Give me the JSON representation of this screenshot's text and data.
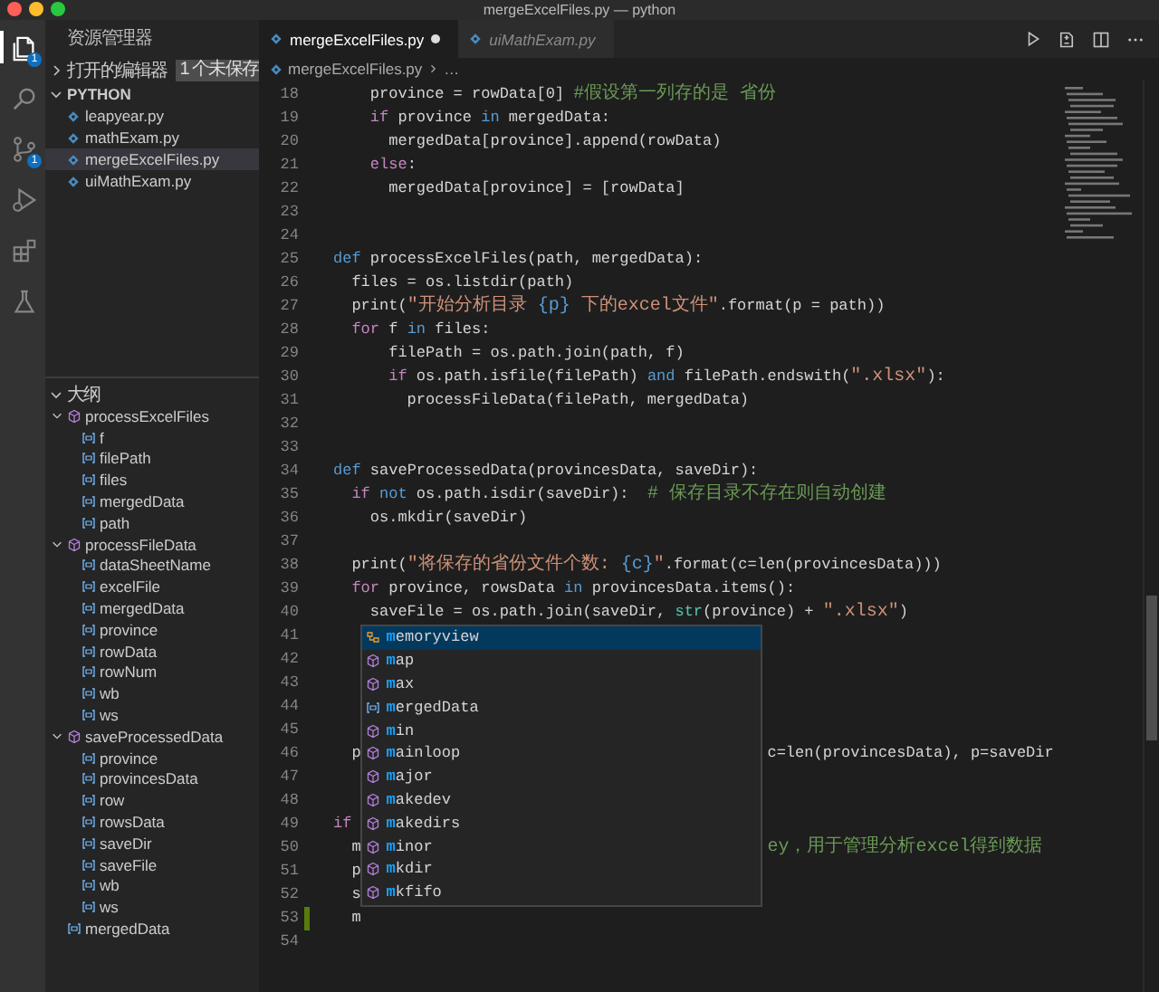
{
  "window": {
    "title": "mergeExcelFiles.py — python"
  },
  "activity_bar": [
    {
      "kind": "files",
      "selected": true,
      "badge": "1"
    },
    {
      "kind": "search",
      "selected": false
    },
    {
      "kind": "source_control",
      "selected": false,
      "badge": "1"
    },
    {
      "kind": "run",
      "selected": false
    },
    {
      "kind": "extensions",
      "selected": false
    },
    {
      "kind": "flask",
      "selected": false
    }
  ],
  "sidebar": {
    "title": "资源管理器",
    "open_editors": {
      "label": "打开的编辑器",
      "expanded": false,
      "badge": "1 个未保存"
    },
    "folder": {
      "label": "PYTHON",
      "expanded": true,
      "files": [
        {
          "name": "leapyear.py",
          "selected": false
        },
        {
          "name": "mathExam.py",
          "selected": false
        },
        {
          "name": "mergeExcelFiles.py",
          "selected": true
        },
        {
          "name": "uiMathExam.py",
          "selected": false
        }
      ]
    },
    "outline": {
      "label": "大纲",
      "expanded": true,
      "children": [
        {
          "label": "processExcelFiles",
          "kind": "function",
          "expanded": true,
          "children": [
            {
              "label": "f",
              "kind": "variable"
            },
            {
              "label": "filePath",
              "kind": "variable"
            },
            {
              "label": "files",
              "kind": "variable"
            },
            {
              "label": "mergedData",
              "kind": "variable"
            },
            {
              "label": "path",
              "kind": "variable"
            }
          ]
        },
        {
          "label": "processFileData",
          "kind": "function",
          "expanded": true,
          "children": [
            {
              "label": "dataSheetName",
              "kind": "variable"
            },
            {
              "label": "excelFile",
              "kind": "variable"
            },
            {
              "label": "mergedData",
              "kind": "variable"
            },
            {
              "label": "province",
              "kind": "variable"
            },
            {
              "label": "rowData",
              "kind": "variable"
            },
            {
              "label": "rowNum",
              "kind": "variable"
            },
            {
              "label": "wb",
              "kind": "variable"
            },
            {
              "label": "ws",
              "kind": "variable"
            }
          ]
        },
        {
          "label": "saveProcessedData",
          "kind": "function",
          "expanded": true,
          "children": [
            {
              "label": "province",
              "kind": "variable"
            },
            {
              "label": "provincesData",
              "kind": "variable"
            },
            {
              "label": "row",
              "kind": "variable"
            },
            {
              "label": "rowsData",
              "kind": "variable"
            },
            {
              "label": "saveDir",
              "kind": "variable"
            },
            {
              "label": "saveFile",
              "kind": "variable"
            },
            {
              "label": "wb",
              "kind": "variable"
            },
            {
              "label": "ws",
              "kind": "variable"
            }
          ]
        },
        {
          "label": "mergedData",
          "kind": "variable"
        }
      ]
    }
  },
  "tabs": [
    {
      "label": "mergeExcelFiles.py",
      "selected": true,
      "modified": true,
      "preview": false
    },
    {
      "label": "uiMathExam.py",
      "selected": false,
      "modified": false,
      "preview": true
    }
  ],
  "breadcrumbs": [
    "mergeExcelFiles.py",
    "…"
  ],
  "code_lines": [
    {
      "number": "18",
      "changed": false,
      "segments": [
        {
          "kind": "plain",
          "text": "    province = rowData[0] "
        },
        {
          "kind": "comment",
          "text": "#假设第一列存的是 省份"
        }
      ]
    },
    {
      "number": "19",
      "changed": false,
      "segments": [
        {
          "kind": "control",
          "text": "    if"
        },
        {
          "kind": "plain",
          "text": " province "
        },
        {
          "kind": "keyword",
          "text": "in"
        },
        {
          "kind": "plain",
          "text": " mergedData:"
        }
      ]
    },
    {
      "number": "20",
      "changed": false,
      "segments": [
        {
          "kind": "plain",
          "text": "      mergedData[province].append(rowData)"
        }
      ]
    },
    {
      "number": "21",
      "changed": false,
      "segments": [
        {
          "kind": "control",
          "text": "    else"
        },
        {
          "kind": "plain",
          "text": ":"
        }
      ]
    },
    {
      "number": "22",
      "changed": false,
      "segments": [
        {
          "kind": "plain",
          "text": "      mergedData[province] = [rowData]"
        }
      ]
    },
    {
      "number": "23",
      "changed": false
    },
    {
      "number": "24",
      "changed": false
    },
    {
      "number": "25",
      "changed": false,
      "segments": [
        {
          "kind": "keyword",
          "text": "def"
        },
        {
          "kind": "plain",
          "text": " processExcelFiles(path, mergedData):"
        }
      ]
    },
    {
      "number": "26",
      "changed": false,
      "segments": [
        {
          "kind": "plain",
          "text": "  files = os.listdir(path)"
        }
      ]
    },
    {
      "number": "27",
      "changed": false,
      "segments": [
        {
          "kind": "plain",
          "text": "  print("
        },
        {
          "kind": "string",
          "text": "\"开始分析目录 "
        },
        {
          "kind": "format",
          "text": "{p}"
        },
        {
          "kind": "string",
          "text": " 下的excel文件\""
        },
        {
          "kind": "plain",
          "text": ".format(p = path))"
        }
      ]
    },
    {
      "number": "28",
      "changed": false,
      "segments": [
        {
          "kind": "control",
          "text": "  for"
        },
        {
          "kind": "plain",
          "text": " f "
        },
        {
          "kind": "keyword",
          "text": "in"
        },
        {
          "kind": "plain",
          "text": " files:"
        }
      ]
    },
    {
      "number": "29",
      "changed": false,
      "segments": [
        {
          "kind": "plain",
          "text": "      filePath = os.path.join(path, f)"
        }
      ]
    },
    {
      "number": "30",
      "changed": false,
      "segments": [
        {
          "kind": "control",
          "text": "      if"
        },
        {
          "kind": "plain",
          "text": " os.path.isfile(filePath) "
        },
        {
          "kind": "keyword",
          "text": "and"
        },
        {
          "kind": "plain",
          "text": " filePath.endswith("
        },
        {
          "kind": "string",
          "text": "\".xlsx\""
        },
        {
          "kind": "plain",
          "text": "):"
        }
      ]
    },
    {
      "number": "31",
      "changed": false,
      "segments": [
        {
          "kind": "plain",
          "text": "        processFileData(filePath, mergedData)"
        }
      ]
    },
    {
      "number": "32",
      "changed": false
    },
    {
      "number": "33",
      "changed": false
    },
    {
      "number": "34",
      "changed": false,
      "segments": [
        {
          "kind": "keyword",
          "text": "def"
        },
        {
          "kind": "plain",
          "text": " saveProcessedData(provincesData, saveDir):"
        }
      ]
    },
    {
      "number": "35",
      "changed": false,
      "segments": [
        {
          "kind": "control",
          "text": "  if "
        },
        {
          "kind": "keyword",
          "text": "not"
        },
        {
          "kind": "plain",
          "text": " os.path.isdir(saveDir):  "
        },
        {
          "kind": "comment",
          "text": "# 保存目录不存在则自动创建"
        }
      ]
    },
    {
      "number": "36",
      "changed": false,
      "segments": [
        {
          "kind": "plain",
          "text": "    os.mkdir(saveDir)"
        }
      ]
    },
    {
      "number": "37",
      "changed": false
    },
    {
      "number": "38",
      "changed": false,
      "segments": [
        {
          "kind": "plain",
          "text": "  print("
        },
        {
          "kind": "string",
          "text": "\"将保存的省份文件个数: "
        },
        {
          "kind": "format",
          "text": "{c}"
        },
        {
          "kind": "string",
          "text": "\""
        },
        {
          "kind": "plain",
          "text": ".format(c=len(provincesData)))"
        }
      ]
    },
    {
      "number": "39",
      "changed": false,
      "segments": [
        {
          "kind": "control",
          "text": "  for"
        },
        {
          "kind": "plain",
          "text": " province, rowsData "
        },
        {
          "kind": "keyword",
          "text": "in"
        },
        {
          "kind": "plain",
          "text": " provincesData.items():"
        }
      ]
    },
    {
      "number": "40",
      "changed": false,
      "segments": [
        {
          "kind": "plain",
          "text": "    saveFile = os.path.join(saveDir, "
        },
        {
          "kind": "type",
          "text": "str"
        },
        {
          "kind": "plain",
          "text": "(province) + "
        },
        {
          "kind": "string",
          "text": "\".xlsx\""
        },
        {
          "kind": "plain",
          "text": ")"
        }
      ]
    },
    {
      "number": "41",
      "changed": false
    },
    {
      "number": "42",
      "changed": false
    },
    {
      "number": "43",
      "changed": false
    },
    {
      "number": "44",
      "changed": false
    },
    {
      "number": "45",
      "changed": false
    },
    {
      "number": "46",
      "changed": false,
      "segments": [
        {
          "kind": "plain",
          "text": "  p"
        }
      ],
      "after_popup": [
        {
          "kind": "plain",
          "text": "c=len(provincesData), p=saveDir"
        }
      ]
    },
    {
      "number": "47",
      "changed": false
    },
    {
      "number": "48",
      "changed": false
    },
    {
      "number": "49",
      "changed": false,
      "segments": [
        {
          "kind": "control",
          "text": "if"
        }
      ]
    },
    {
      "number": "50",
      "changed": false,
      "segments": [
        {
          "kind": "plain",
          "text": "  m"
        }
      ],
      "after_popup": [
        {
          "kind": "comment",
          "text": "ey，用于管理分析excel得到数据"
        }
      ]
    },
    {
      "number": "51",
      "changed": false,
      "segments": [
        {
          "kind": "plain",
          "text": "  p"
        }
      ]
    },
    {
      "number": "52",
      "changed": false,
      "segments": [
        {
          "kind": "plain",
          "text": "  s"
        }
      ]
    },
    {
      "number": "53",
      "changed": true,
      "segments": [
        {
          "kind": "plain",
          "text": "  m"
        }
      ]
    },
    {
      "number": "54",
      "changed": false
    }
  ],
  "suggestions": [
    {
      "label": "**m**emoryview",
      "kind": "class",
      "selected": true
    },
    {
      "label": "**m**ap",
      "kind": "function",
      "selected": false
    },
    {
      "label": "**m**ax",
      "kind": "function",
      "selected": false
    },
    {
      "label": "**m**ergedData",
      "kind": "variable",
      "selected": false
    },
    {
      "label": "**m**in",
      "kind": "function",
      "selected": false
    },
    {
      "label": "**m**ainloop",
      "kind": "function",
      "selected": false
    },
    {
      "label": "**m**ajor",
      "kind": "function",
      "selected": false
    },
    {
      "label": "**m**akedev",
      "kind": "function",
      "selected": false
    },
    {
      "label": "**m**akedirs",
      "kind": "function",
      "selected": false
    },
    {
      "label": "**m**inor",
      "kind": "function",
      "selected": false
    },
    {
      "label": "**m**kdir",
      "kind": "function",
      "selected": false
    },
    {
      "label": "**m**kfifo",
      "kind": "function",
      "selected": false
    }
  ]
}
